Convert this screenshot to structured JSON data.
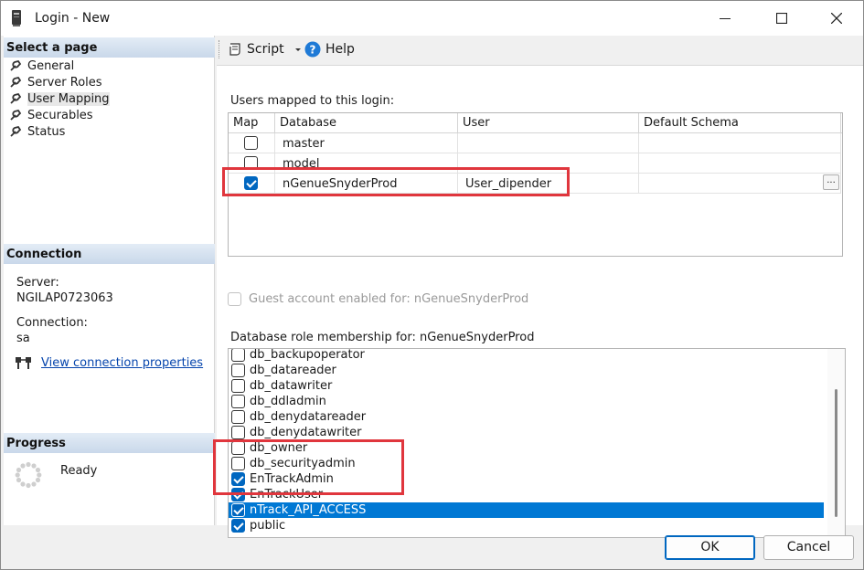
{
  "window": {
    "title": "Login - New"
  },
  "left": {
    "select_page_header": "Select a page",
    "pages": [
      {
        "label": "General"
      },
      {
        "label": "Server Roles"
      },
      {
        "label": "User Mapping"
      },
      {
        "label": "Securables"
      },
      {
        "label": "Status"
      }
    ],
    "selected_page": "User Mapping",
    "connection_header": "Connection",
    "server_label": "Server:",
    "server_value": "NGILAP0723063",
    "connection_label": "Connection:",
    "connection_value": "sa",
    "view_connection_link": "View connection properties",
    "progress_header": "Progress",
    "progress_status": "Ready"
  },
  "toolbar": {
    "script_label": "Script",
    "help_label": "Help"
  },
  "mapping": {
    "group_label": "Users mapped to this login:",
    "columns": [
      "Map",
      "Database",
      "User",
      "Default Schema"
    ],
    "rows": [
      {
        "checked": false,
        "database": "master",
        "user": "",
        "schema": ""
      },
      {
        "checked": false,
        "database": "model",
        "user": "",
        "schema": ""
      },
      {
        "checked": true,
        "database": "nGenueSnyderProd",
        "user": "User_dipender",
        "schema": ""
      }
    ],
    "ellipsis_label": "...",
    "guest_label": "Guest account enabled for: nGenueSnyderProd"
  },
  "roles": {
    "group_label": "Database role membership for: nGenueSnyderProd",
    "items": [
      {
        "label": "db_backupoperator",
        "checked": false
      },
      {
        "label": "db_datareader",
        "checked": false
      },
      {
        "label": "db_datawriter",
        "checked": false
      },
      {
        "label": "db_ddladmin",
        "checked": false
      },
      {
        "label": "db_denydatareader",
        "checked": false
      },
      {
        "label": "db_denydatawriter",
        "checked": false
      },
      {
        "label": "db_owner",
        "checked": false
      },
      {
        "label": "db_securityadmin",
        "checked": false
      },
      {
        "label": "EnTrackAdmin",
        "checked": true
      },
      {
        "label": "EnTrackUser",
        "checked": true
      },
      {
        "label": "nTrack_API_ACCESS",
        "checked": true,
        "selected": true
      },
      {
        "label": "public",
        "checked": true
      }
    ]
  },
  "buttons": {
    "ok": "OK",
    "cancel": "Cancel"
  },
  "colors": {
    "highlight": "#e0363d",
    "selection": "#0078d4",
    "checkbox": "#0067c0",
    "link": "#0645ad"
  }
}
